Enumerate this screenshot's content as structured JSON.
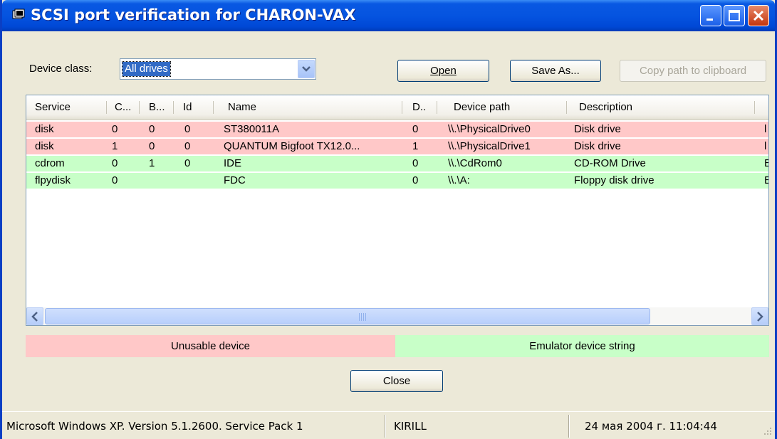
{
  "window": {
    "title": "SCSI port verification for CHARON-VAX"
  },
  "toolbar": {
    "device_class_label": "Device class:",
    "device_class_value": "All drives",
    "open_label": "Open",
    "save_as_label": "Save As...",
    "copy_path_label": "Copy path to clipboard"
  },
  "table": {
    "columns": [
      "Service",
      "C...",
      "B...",
      "Id",
      "Name",
      "D..",
      "Device path",
      "Description"
    ],
    "rows": [
      {
        "status": "unusable",
        "cells": [
          "disk",
          "0",
          "0",
          "0",
          "ST380011A",
          "0",
          "\\\\.\\PhysicalDrive0",
          "Disk drive"
        ],
        "extra": "l"
      },
      {
        "status": "unusable",
        "cells": [
          "disk",
          "1",
          "0",
          "0",
          "QUANTUM Bigfoot TX12.0...",
          "1",
          "\\\\.\\PhysicalDrive1",
          "Disk drive"
        ],
        "extra": "l"
      },
      {
        "status": "emulator",
        "cells": [
          "cdrom",
          "0",
          "1",
          "0",
          "IDE",
          "0",
          "\\\\.\\CdRom0",
          "CD-ROM Drive"
        ],
        "extra": "E"
      },
      {
        "status": "emulator",
        "cells": [
          "flpydisk",
          "0",
          "",
          "",
          "FDC",
          "0",
          "\\\\.\\A:",
          "Floppy disk drive"
        ],
        "extra": "E"
      }
    ]
  },
  "legend": {
    "unusable_label": "Unusable device",
    "emulator_label": "Emulator device string",
    "unusable_color": "#ffc8c8",
    "emulator_color": "#c8ffc8"
  },
  "close_label": "Close",
  "status": {
    "os": "Microsoft Windows XP. Version 5.1.2600. Service Pack 1",
    "host": "KIRILL",
    "datetime": "24 мая 2004 г. 11:04:44"
  }
}
